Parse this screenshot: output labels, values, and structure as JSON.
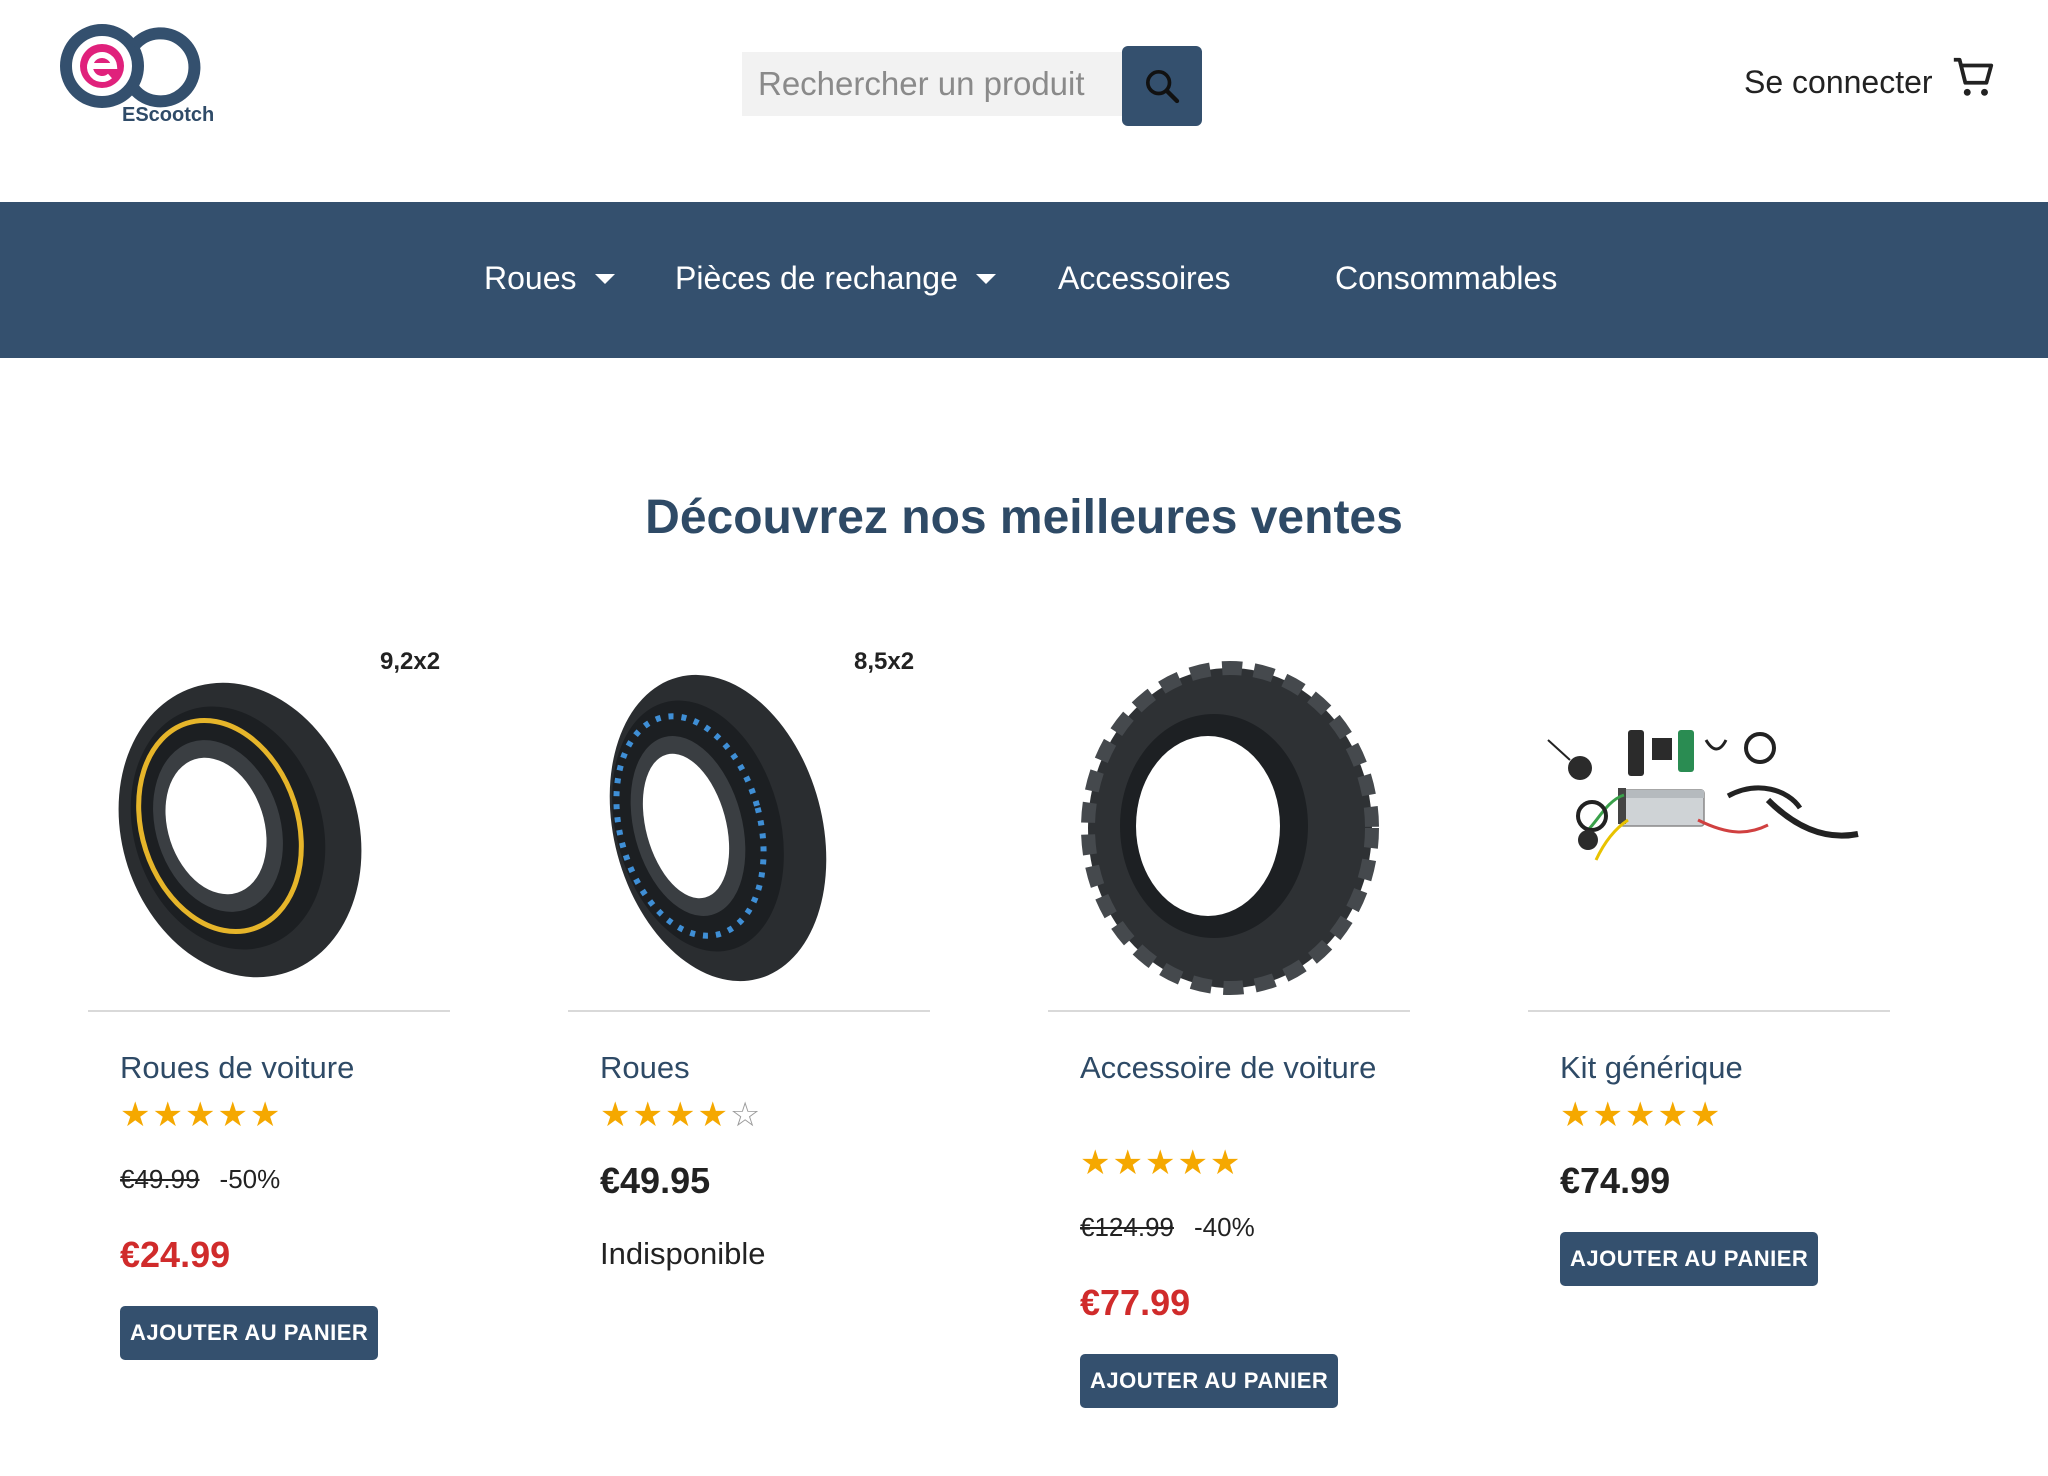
{
  "brand": {
    "logo_text": "EScootch"
  },
  "search": {
    "placeholder": "Rechercher un produit"
  },
  "header": {
    "signin_label": "Se connecter"
  },
  "nav": {
    "items": [
      {
        "label": "Roues"
      },
      {
        "label": "Pièces de rechange"
      },
      {
        "label": "Accessoires"
      },
      {
        "label": "Consommables"
      }
    ]
  },
  "section": {
    "title": "Découvrez nos meilleures ventes"
  },
  "colors": {
    "primary": "#34506e",
    "sale_red": "#d02b2b",
    "star": "#f5a800"
  },
  "products": [
    {
      "name": "Roues de voiture",
      "size_label": "9,2x2",
      "rating": 5,
      "old_price": "€49.99",
      "discount": "-50%",
      "price": "€24.99",
      "button": "AJOUTER AU PANIER"
    },
    {
      "name": "Roues",
      "size_label": "8,5x2",
      "rating": 4,
      "price": "€49.95",
      "status": "Indisponible"
    },
    {
      "name": "Accessoire de voiture",
      "rating": 5,
      "old_price": "€124.99",
      "discount": "-40%",
      "price": "€77.99",
      "button": "AJOUTER AU PANIER"
    },
    {
      "name": "Kit générique",
      "rating": 5,
      "price": "€74.99",
      "button": "AJOUTER AU PANIER"
    }
  ]
}
